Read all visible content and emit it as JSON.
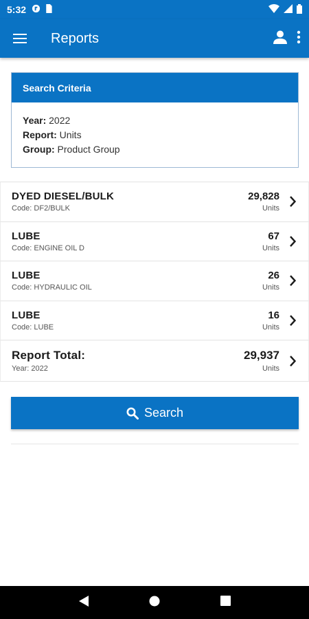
{
  "status_bar": {
    "time": "5:32"
  },
  "app_bar": {
    "title": "Reports"
  },
  "criteria": {
    "header": "Search Criteria",
    "year_label": "Year:",
    "year_value": "2022",
    "report_label": "Report:",
    "report_value": "Units",
    "group_label": "Group:",
    "group_value": "Product Group"
  },
  "items": [
    {
      "name": "DYED DIESEL/BULK",
      "code": "Code: DF2/BULK",
      "value": "29,828",
      "unit": "Units"
    },
    {
      "name": "LUBE",
      "code": "Code: ENGINE OIL D",
      "value": "67",
      "unit": "Units"
    },
    {
      "name": "LUBE",
      "code": "Code: HYDRAULIC OIL",
      "value": "26",
      "unit": "Units"
    },
    {
      "name": "LUBE",
      "code": "Code: LUBE",
      "value": "16",
      "unit": "Units"
    }
  ],
  "total": {
    "label": "Report Total:",
    "year": "Year: 2022",
    "value": "29,937",
    "unit": "Units"
  },
  "search_button": {
    "label": "Search"
  },
  "colors": {
    "primary": "#0a73c4",
    "nav": "#000000"
  },
  "icons": [
    "menu-icon",
    "account-icon",
    "more-vert-icon",
    "chevron-right-icon",
    "search-icon",
    "back-icon",
    "home-icon",
    "recents-icon"
  ]
}
